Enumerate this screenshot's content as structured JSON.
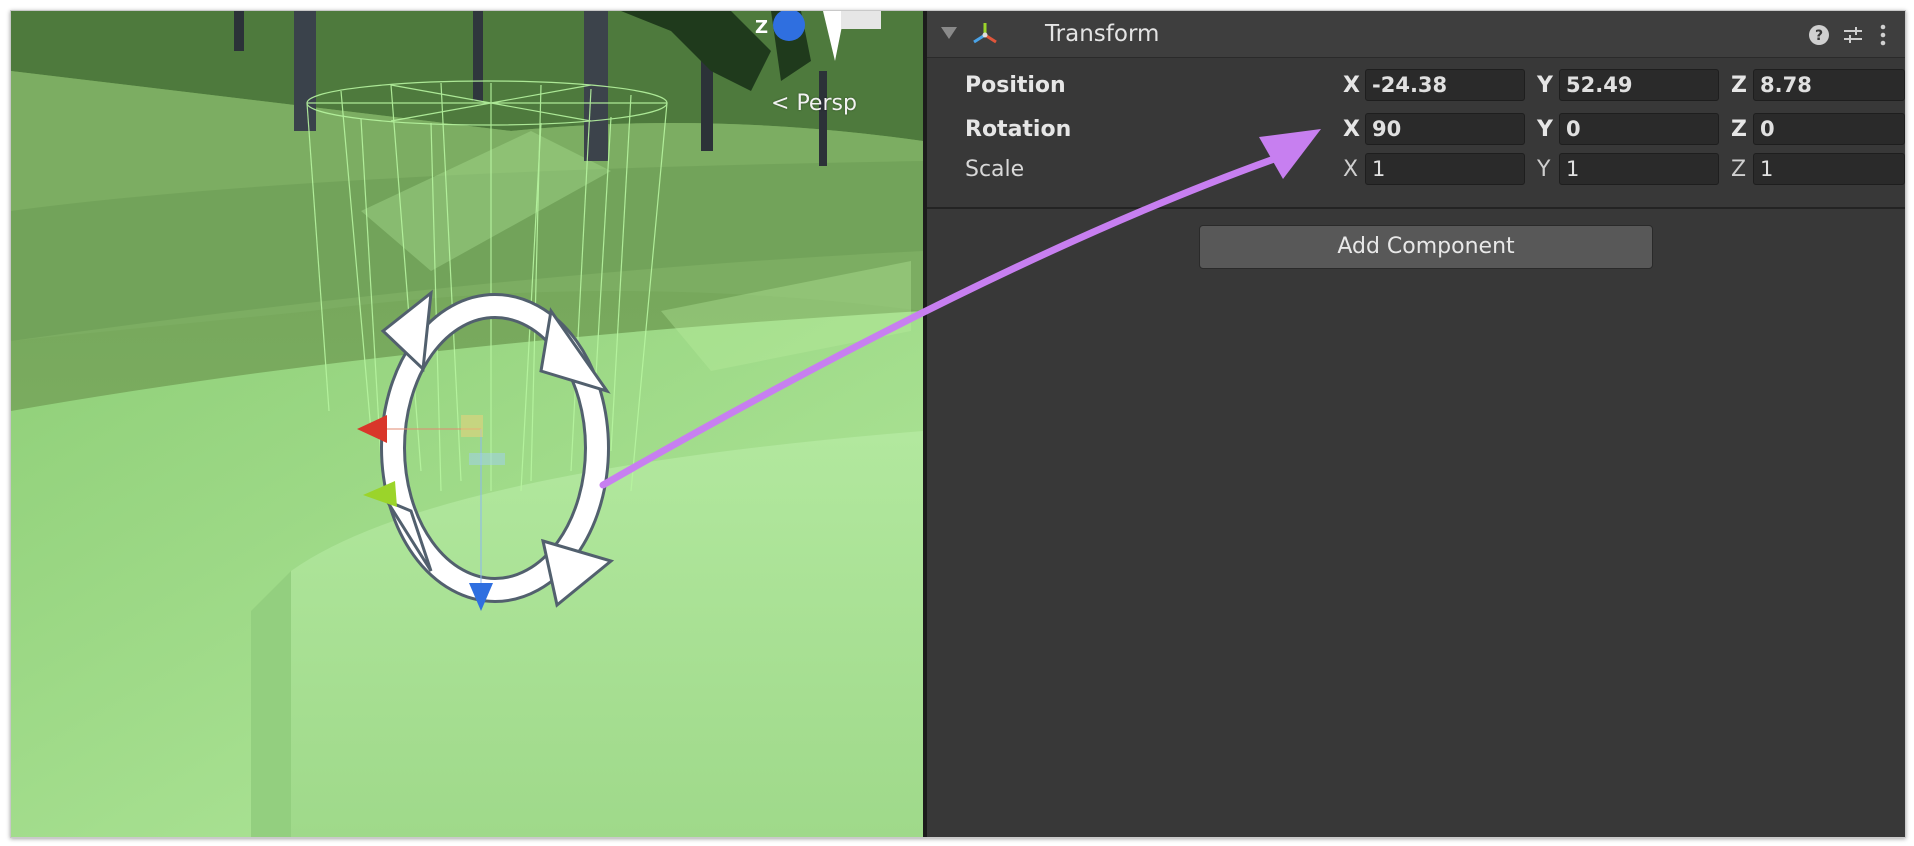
{
  "scene_view": {
    "camera_mode_label": "Persp",
    "gizmo_axis_label": "Z"
  },
  "inspector": {
    "component": {
      "title": "Transform",
      "icons": [
        "transform-icon",
        "help-icon",
        "preset-icon",
        "more-options-icon"
      ]
    },
    "transform": {
      "position": {
        "label": "Position",
        "x_label": "X",
        "x": "-24.38",
        "y_label": "Y",
        "y": "52.49",
        "z_label": "Z",
        "z": "8.78"
      },
      "rotation": {
        "label": "Rotation",
        "x_label": "X",
        "x": "90",
        "y_label": "Y",
        "y": "0",
        "z_label": "Z",
        "z": "0"
      },
      "scale": {
        "label": "Scale",
        "x_label": "X",
        "x": "1",
        "y_label": "Y",
        "y": "1",
        "z_label": "Z",
        "z": "1"
      }
    },
    "add_component_label": "Add Component"
  },
  "annotation": {
    "arrow_color": "#c77ff0"
  },
  "colors": {
    "inspector_bg": "#383838",
    "field_bg": "#2a2a2a",
    "grass_light": "#aee39a",
    "gizmo_red": "#d9362a",
    "gizmo_green": "#9bd42a",
    "gizmo_blue": "#2f6fe0"
  }
}
